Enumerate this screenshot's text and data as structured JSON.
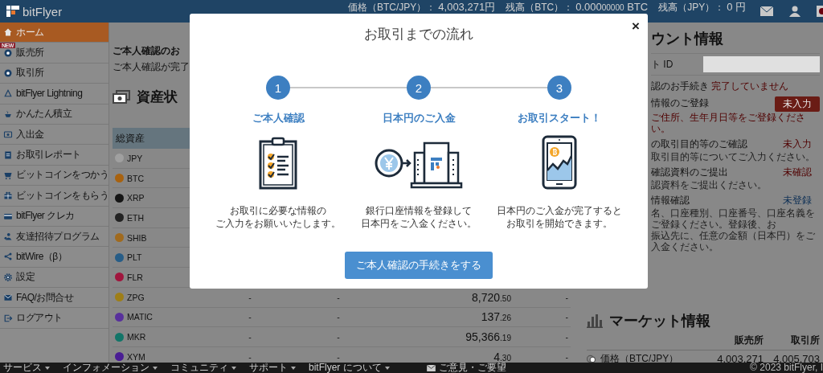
{
  "header": {
    "logo": "bitFlyer",
    "price_label": "価格（BTC/JPY）：",
    "price": "4,003,271円",
    "btc_label": "残高（BTC）：",
    "btc_main": "0.000",
    "btc_small": "00000",
    "btc_unit": "BTC",
    "jpy_label": "残高（JPY）：",
    "jpy_value": "0 円"
  },
  "sidebar": {
    "items": [
      {
        "label": "ホーム",
        "selected": true
      },
      {
        "label": "販売所",
        "selected": false,
        "badge": "NEW"
      },
      {
        "label": "取引所",
        "selected": false
      },
      {
        "label": "bitFlyer Lightning",
        "selected": false
      },
      {
        "label": "かんたん積立",
        "selected": false
      },
      {
        "label": "入出金",
        "selected": false
      },
      {
        "label": "お取引レポート",
        "selected": false
      },
      {
        "label": "ビットコインをつかう",
        "selected": false
      },
      {
        "label": "ビットコインをもらう",
        "selected": false
      },
      {
        "label": "bitFlyer クレカ",
        "selected": false
      },
      {
        "label": "友達招待プログラム",
        "selected": false
      },
      {
        "label": "bitWire（β）",
        "selected": false
      },
      {
        "label": "設定",
        "selected": false
      },
      {
        "label": "FAQ/お問合せ",
        "selected": false
      },
      {
        "label": "ログアウト",
        "selected": false
      }
    ]
  },
  "main": {
    "notice_title": "ご本人確認のお",
    "notice_text": "ご本人確認が完了",
    "assets_heading": "資産状",
    "table": {
      "header": "総資産",
      "rows": [
        {
          "coin": "JPY",
          "color": "#a0a0a0"
        },
        {
          "coin": "BTC",
          "color": "#a8620f"
        },
        {
          "coin": "XRP",
          "color": "#151515"
        },
        {
          "coin": "ETH",
          "color": "#222222"
        },
        {
          "coin": "SHIB",
          "color": "#a06a1e"
        },
        {
          "coin": "PLT",
          "color": "#275d87"
        },
        {
          "coin": "FLR",
          "color": "#a0153d"
        },
        {
          "coin": "ZPG",
          "color": "#9e7e17",
          "column_2": "-",
          "column_3": "-",
          "amount": "8,720",
          "amount_decimal": ".50",
          "column_5": "-"
        },
        {
          "coin": "MATIC",
          "color": "#58309c",
          "column_2": "-",
          "column_3": "-",
          "amount": "137",
          "amount_decimal": ".26",
          "column_5": "-"
        },
        {
          "coin": "MKR",
          "color": "#127568",
          "column_2": "-",
          "column_3": "-",
          "amount": "95,366",
          "amount_decimal": ".19",
          "column_5": "-"
        },
        {
          "coin": "XYM",
          "color": "#4a1d94",
          "column_2": "-",
          "column_3": "-",
          "amount": "4",
          "amount_decimal": ".30",
          "column_5": "-"
        }
      ]
    }
  },
  "account": {
    "heading": "ウント情報",
    "id_label": "ト ID",
    "status_label": "認のお手続き",
    "status_value": "完了していません",
    "steps": [
      {
        "title": "情報のご登録",
        "notes": [
          "ご住所、生年月日等をご登録ください。"
        ],
        "status": "未入力",
        "kind": "badge"
      },
      {
        "title": "の取引目的等のご確認",
        "notes": [
          "取引目的等についてご入力ください。"
        ],
        "status": "未入力",
        "kind": "alert"
      },
      {
        "title": "確認資料のご提出",
        "notes": [
          "認資料をご提出ください。"
        ],
        "status": "未確認",
        "kind": "alert"
      },
      {
        "title": "情報確認",
        "notes": [
          "名、口座種別、口座番号、口座名義をご登録ください。登録後、お",
          "振込先に、任意の金額（日本円）をご入金ください。"
        ],
        "status": "未登録",
        "kind": "info"
      }
    ]
  },
  "market": {
    "heading": "マーケット情報",
    "columns": [
      "販売所",
      "取引所"
    ],
    "rows": [
      {
        "label": "価格（BTC/JPY）",
        "values": [
          "4,003,271",
          "4,005,703"
        ]
      }
    ]
  },
  "footer": {
    "menus": [
      "サービス",
      "インフォメーション",
      "コミュニティ",
      "サポート",
      "bitFlyer について"
    ],
    "feedback": "ご意見・ご要望",
    "copyright": "© 2023 bitFlyer, I"
  },
  "modal": {
    "title": "お取引までの流れ",
    "close": "×",
    "steps": [
      {
        "number": "1",
        "title": "ご本人確認",
        "desc": [
          "お取引に必要な情報の",
          "ご入力をお願いいたします。"
        ]
      },
      {
        "number": "2",
        "title": "日本円のご入金",
        "desc": [
          "銀行口座情報を登録して",
          "日本円をご入金ください。"
        ]
      },
      {
        "number": "3",
        "title": "お取引スタート！",
        "desc": [
          "日本円のご入金が完了すると",
          "お取引を開始できます。"
        ]
      }
    ],
    "button": "ご本人確認の手続きをする"
  }
}
